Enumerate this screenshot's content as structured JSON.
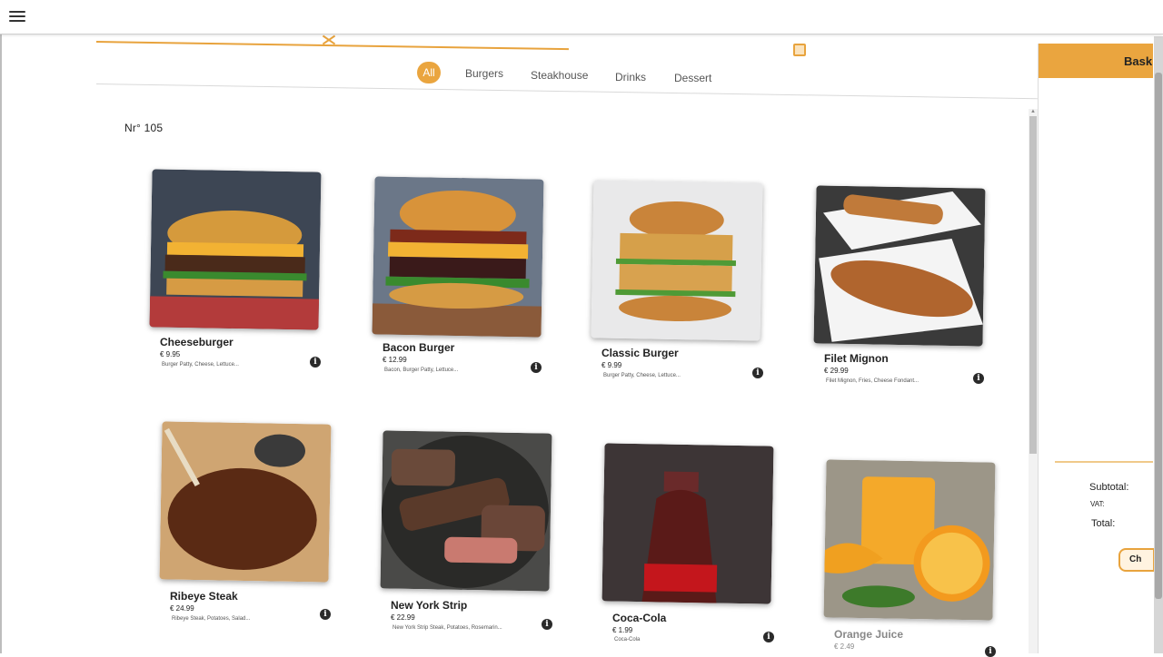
{
  "app": {
    "menu_icon": "hamburger-icon"
  },
  "tabs": [
    "All",
    "Burgers",
    "Steakhouse",
    "Drinks",
    "Dessert"
  ],
  "active_tab": "All",
  "order": {
    "label": "Nr° 105"
  },
  "products": [
    {
      "name": "Cheeseburger",
      "price": "€ 9.95",
      "desc": "Burger Patty, Cheese, Lettuce..."
    },
    {
      "name": "Bacon Burger",
      "price": "€ 12.99",
      "desc": "Bacon, Burger Patty, Lettuce..."
    },
    {
      "name": "Classic Burger",
      "price": "€ 9.99",
      "desc": "Burger Patty, Cheese, Lettuce..."
    },
    {
      "name": "Filet Mignon",
      "price": "€ 29.99",
      "desc": "Filet Mignon, Fries, Cheese Fondant..."
    },
    {
      "name": "Ribeye Steak",
      "price": "€ 24.99",
      "desc": "Ribeye Steak, Potatoes, Salad..."
    },
    {
      "name": "New York Strip",
      "price": "€ 22.99",
      "desc": "New York Strip Steak, Potatoes, Rosemarin..."
    },
    {
      "name": "Coca-Cola",
      "price": "€ 1.99",
      "desc": "Coca-Cola"
    },
    {
      "name": "Orange Juice",
      "price": "€ 2.49",
      "desc": ""
    }
  ],
  "basket": {
    "title": "Bask",
    "subtotal_label": "Subtotal:",
    "vat_label": "VAT:",
    "total_label": "Total:",
    "checkout_label": "Ch"
  },
  "colors": {
    "accent": "#eaa53f",
    "text": "#222222"
  }
}
